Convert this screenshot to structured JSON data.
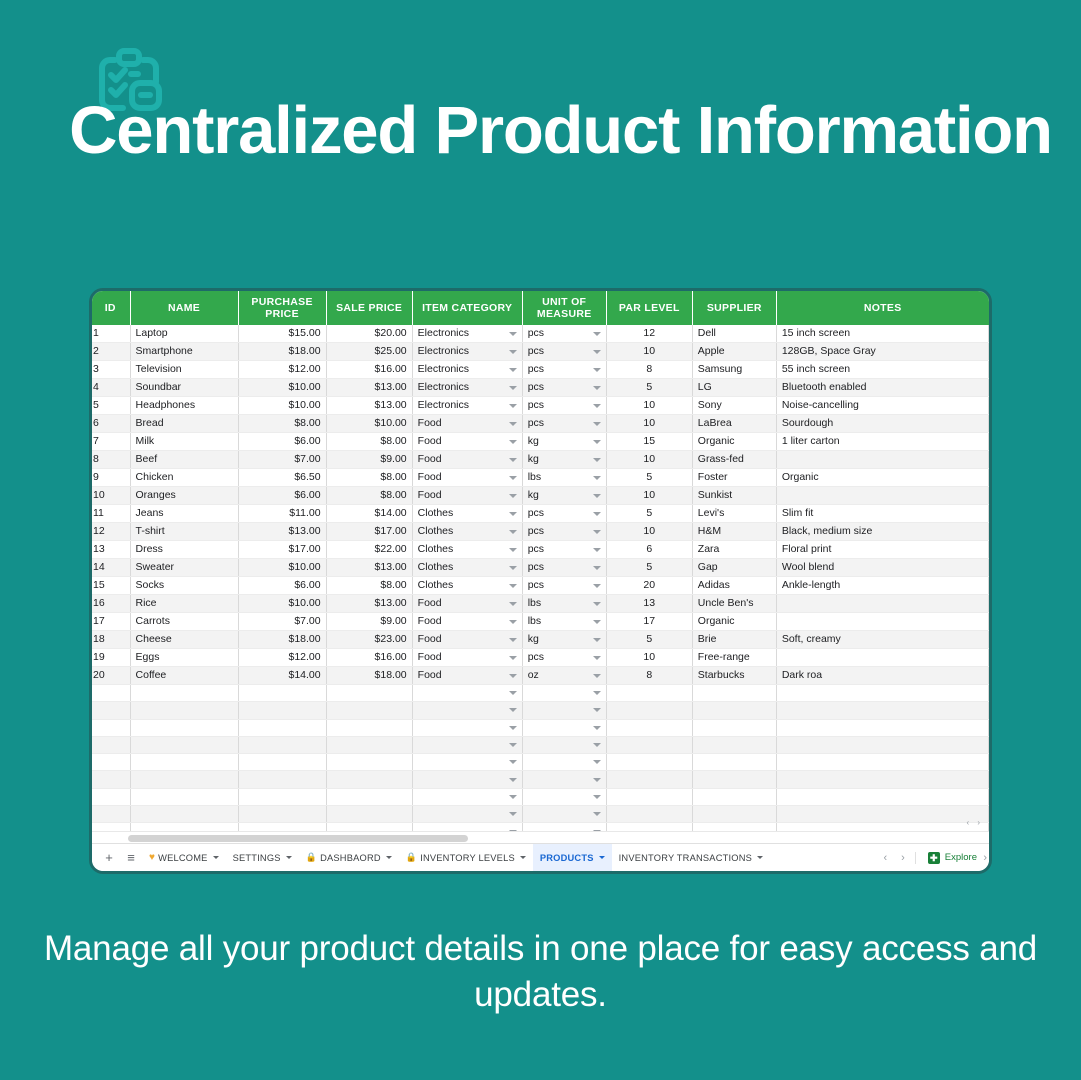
{
  "brand": {
    "logo_icon": "clipboard-checklist-icon",
    "bg_color": "#13908b",
    "logo_color": "#1fb0ab",
    "header_green": "#33a84c",
    "active_tab_color": "#1967d2"
  },
  "title": "Centralized Product Information",
  "caption": "Manage all your product details in one place for easy access and updates.",
  "sheet": {
    "columns": [
      "ID",
      "NAME",
      "PURCHASE PRICE",
      "SALE PRICE",
      "ITEM CATEGORY",
      "UNIT OF MEASURE",
      "PAR LEVEL",
      "SUPPLIER",
      "NOTES"
    ],
    "rows": [
      {
        "id": "1",
        "name": "Laptop",
        "purchase_price": "$15.00",
        "sale_price": "$20.00",
        "category": "Electronics",
        "uom": "pcs",
        "par_level": "12",
        "supplier": "Dell",
        "notes": "15 inch screen"
      },
      {
        "id": "2",
        "name": "Smartphone",
        "purchase_price": "$18.00",
        "sale_price": "$25.00",
        "category": "Electronics",
        "uom": "pcs",
        "par_level": "10",
        "supplier": "Apple",
        "notes": "128GB, Space Gray"
      },
      {
        "id": "3",
        "name": "Television",
        "purchase_price": "$12.00",
        "sale_price": "$16.00",
        "category": "Electronics",
        "uom": "pcs",
        "par_level": "8",
        "supplier": "Samsung",
        "notes": "55 inch screen"
      },
      {
        "id": "4",
        "name": "Soundbar",
        "purchase_price": "$10.00",
        "sale_price": "$13.00",
        "category": "Electronics",
        "uom": "pcs",
        "par_level": "5",
        "supplier": "LG",
        "notes": "Bluetooth enabled"
      },
      {
        "id": "5",
        "name": "Headphones",
        "purchase_price": "$10.00",
        "sale_price": "$13.00",
        "category": "Electronics",
        "uom": "pcs",
        "par_level": "10",
        "supplier": "Sony",
        "notes": "Noise-cancelling"
      },
      {
        "id": "6",
        "name": "Bread",
        "purchase_price": "$8.00",
        "sale_price": "$10.00",
        "category": "Food",
        "uom": "pcs",
        "par_level": "10",
        "supplier": "LaBrea",
        "notes": "Sourdough"
      },
      {
        "id": "7",
        "name": "Milk",
        "purchase_price": "$6.00",
        "sale_price": "$8.00",
        "category": "Food",
        "uom": "kg",
        "par_level": "15",
        "supplier": "Organic",
        "notes": "1 liter carton"
      },
      {
        "id": "8",
        "name": "Beef",
        "purchase_price": "$7.00",
        "sale_price": "$9.00",
        "category": "Food",
        "uom": "kg",
        "par_level": "10",
        "supplier": "Grass-fed",
        "notes": ""
      },
      {
        "id": "9",
        "name": "Chicken",
        "purchase_price": "$6.50",
        "sale_price": "$8.00",
        "category": "Food",
        "uom": "lbs",
        "par_level": "5",
        "supplier": "Foster",
        "notes": "Organic"
      },
      {
        "id": "10",
        "name": "Oranges",
        "purchase_price": "$6.00",
        "sale_price": "$8.00",
        "category": "Food",
        "uom": "kg",
        "par_level": "10",
        "supplier": "Sunkist",
        "notes": ""
      },
      {
        "id": "11",
        "name": "Jeans",
        "purchase_price": "$11.00",
        "sale_price": "$14.00",
        "category": "Clothes",
        "uom": "pcs",
        "par_level": "5",
        "supplier": "Levi's",
        "notes": "Slim fit"
      },
      {
        "id": "12",
        "name": "T-shirt",
        "purchase_price": "$13.00",
        "sale_price": "$17.00",
        "category": "Clothes",
        "uom": "pcs",
        "par_level": "10",
        "supplier": "H&M",
        "notes": "Black, medium size"
      },
      {
        "id": "13",
        "name": "Dress",
        "purchase_price": "$17.00",
        "sale_price": "$22.00",
        "category": "Clothes",
        "uom": "pcs",
        "par_level": "6",
        "supplier": "Zara",
        "notes": "Floral print"
      },
      {
        "id": "14",
        "name": "Sweater",
        "purchase_price": "$10.00",
        "sale_price": "$13.00",
        "category": "Clothes",
        "uom": "pcs",
        "par_level": "5",
        "supplier": "Gap",
        "notes": "Wool blend"
      },
      {
        "id": "15",
        "name": "Socks",
        "purchase_price": "$6.00",
        "sale_price": "$8.00",
        "category": "Clothes",
        "uom": "pcs",
        "par_level": "20",
        "supplier": "Adidas",
        "notes": "Ankle-length"
      },
      {
        "id": "16",
        "name": "Rice",
        "purchase_price": "$10.00",
        "sale_price": "$13.00",
        "category": "Food",
        "uom": "lbs",
        "par_level": "13",
        "supplier": "Uncle Ben's",
        "notes": ""
      },
      {
        "id": "17",
        "name": "Carrots",
        "purchase_price": "$7.00",
        "sale_price": "$9.00",
        "category": "Food",
        "uom": "lbs",
        "par_level": "17",
        "supplier": "Organic",
        "notes": ""
      },
      {
        "id": "18",
        "name": "Cheese",
        "purchase_price": "$18.00",
        "sale_price": "$23.00",
        "category": "Food",
        "uom": "kg",
        "par_level": "5",
        "supplier": "Brie",
        "notes": "Soft, creamy"
      },
      {
        "id": "19",
        "name": "Eggs",
        "purchase_price": "$12.00",
        "sale_price": "$16.00",
        "category": "Food",
        "uom": "pcs",
        "par_level": "10",
        "supplier": "Free-range",
        "notes": ""
      },
      {
        "id": "20",
        "name": "Coffee",
        "purchase_price": "$14.00",
        "sale_price": "$18.00",
        "category": "Food",
        "uom": "oz",
        "par_level": "8",
        "supplier": "Starbucks",
        "notes": "Dark roa"
      }
    ],
    "empty_row_count": 10
  },
  "tabbar": {
    "add_label": "+",
    "menu_label": "≡",
    "tabs": [
      {
        "label": "WELCOME",
        "icon": "heart-icon",
        "active": false
      },
      {
        "label": "SETTINGS",
        "icon": "",
        "active": false
      },
      {
        "label": "DASHBAORD",
        "icon": "lock-icon",
        "active": false
      },
      {
        "label": "INVENTORY LEVELS",
        "icon": "lock-icon",
        "active": false
      },
      {
        "label": "PRODUCTS",
        "icon": "",
        "active": true
      },
      {
        "label": "INVENTORY TRANSACTIONS",
        "icon": "",
        "active": false
      }
    ],
    "prev_label": "‹",
    "next_label": "›",
    "explore_label": "Explore",
    "explore_badge": "✚"
  }
}
